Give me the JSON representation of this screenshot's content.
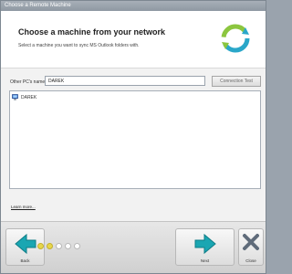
{
  "window": {
    "title": "Choose a Remote Machine"
  },
  "header": {
    "heading": "Choose a machine from your network",
    "subheading": "Select a machine you want to sync MS Outlook folders with."
  },
  "form": {
    "label": "Other PC's name:",
    "value": "DAREK",
    "connection_test_label": "Connection Test"
  },
  "machines": [
    {
      "name": "DAREK"
    }
  ],
  "links": {
    "learn_more": "Learn more..."
  },
  "footer": {
    "back_label": "Back",
    "next_label": "Next",
    "close_label": "Close",
    "steps_total": 5,
    "steps_done": 2
  },
  "colors": {
    "next_accent": "#1aa6b2",
    "back_accent": "#1aa6b2",
    "close_accent": "#5f6b7a",
    "step_active": "#e7d64a"
  }
}
